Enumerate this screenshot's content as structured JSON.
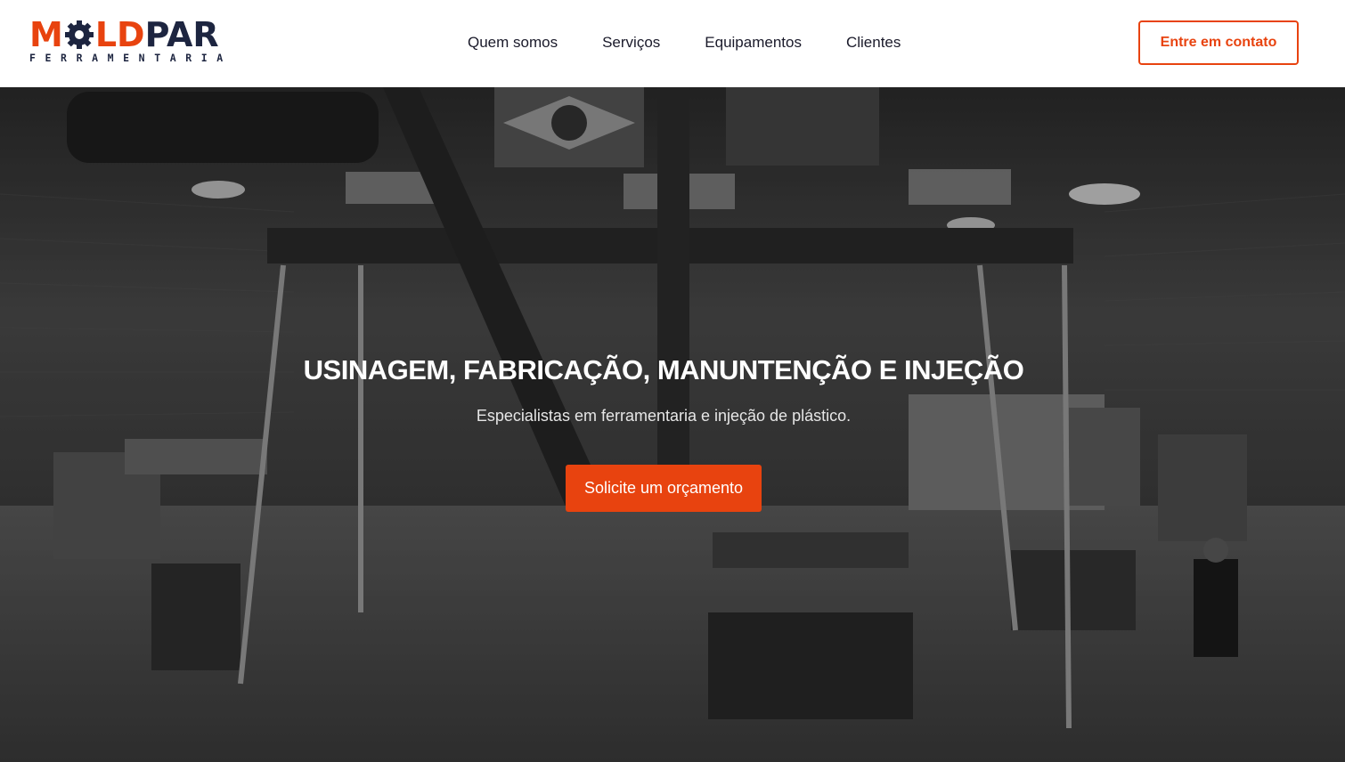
{
  "brand": {
    "name_part1": "M",
    "name_part2": "LD",
    "name_part3": "PAR",
    "tagline": "FERRAMENTARIA",
    "logo_icon": "gear-icon",
    "colors": {
      "accent": "#e8430f",
      "navy": "#1d2540"
    }
  },
  "nav": {
    "items": [
      {
        "label": "Quem somos"
      },
      {
        "label": "Serviços"
      },
      {
        "label": "Equipamentos"
      },
      {
        "label": "Clientes"
      }
    ],
    "cta_label": "Entre em contato"
  },
  "hero": {
    "title": "USINAGEM, FABRICAÇÃO, MANUNTENÇÃO E INJEÇÃO",
    "subtitle": "Especialistas em ferramentaria e injeção de plástico.",
    "button_label": "Solicite um orçamento",
    "background": "factory-floor-photo-grayscale"
  }
}
